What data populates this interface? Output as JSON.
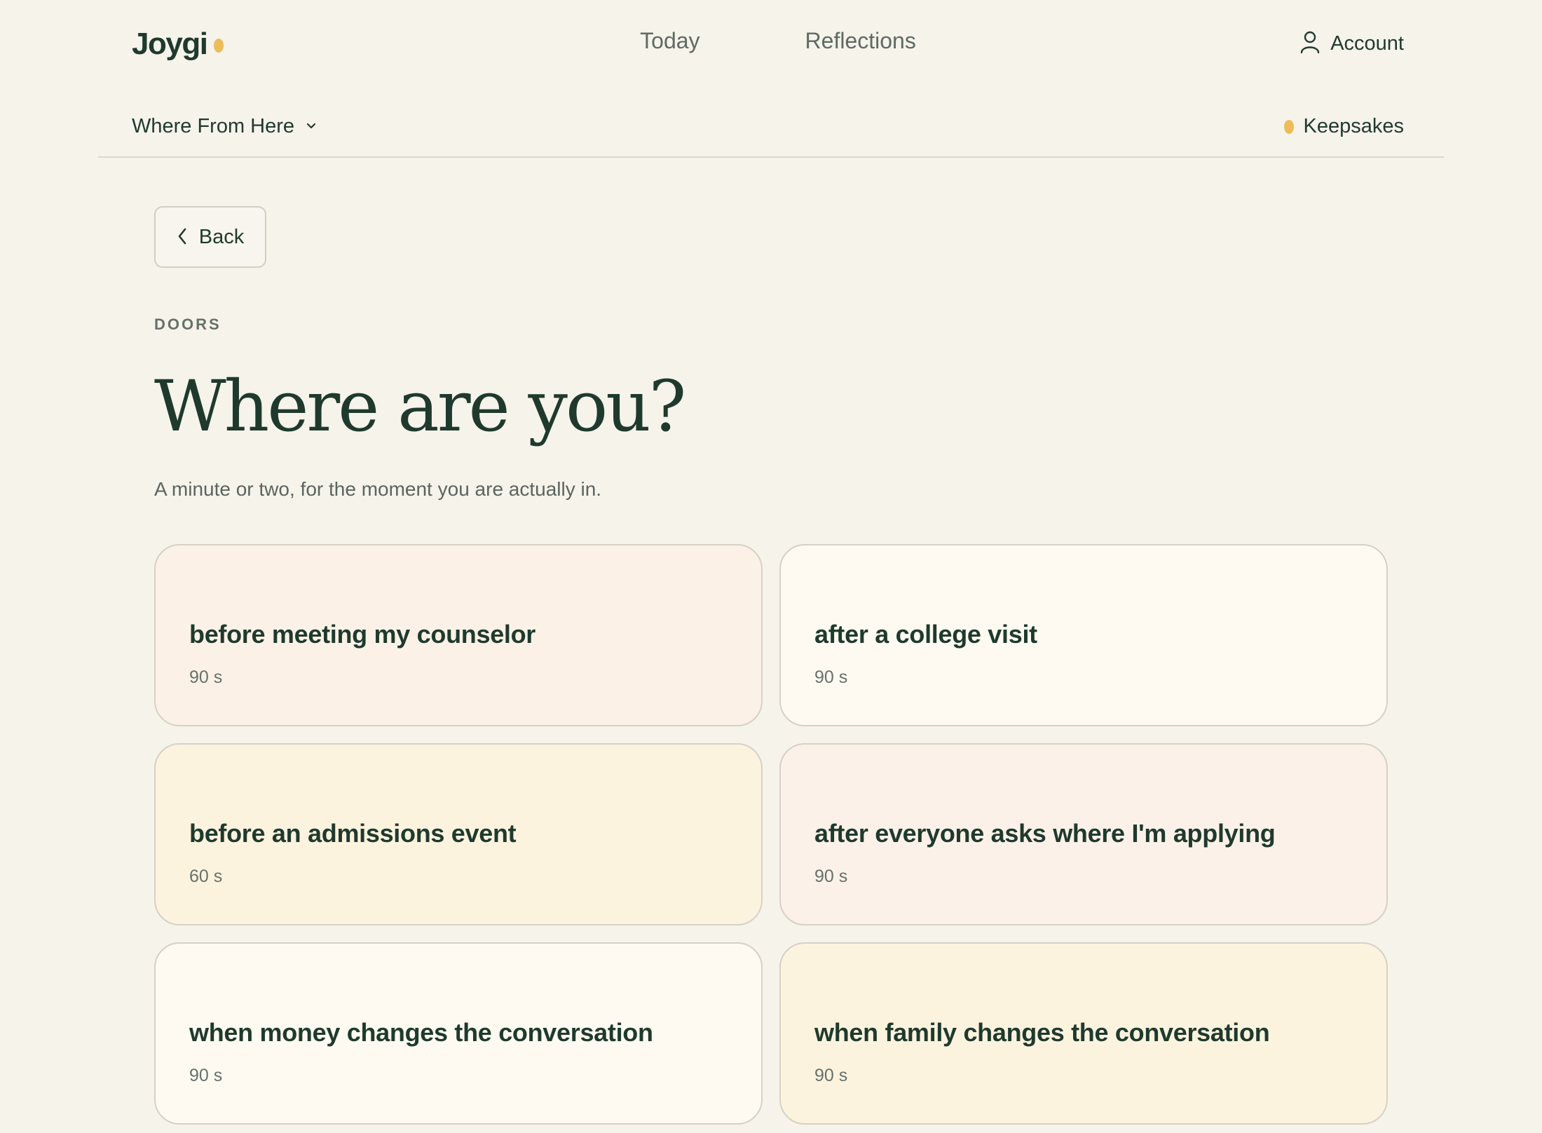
{
  "brand": {
    "name": "Joygi",
    "accent": "#ecbd58",
    "ink": "#1f3a2d",
    "background": "#f6f3eb"
  },
  "nav": {
    "tabs": [
      {
        "label": "Today"
      },
      {
        "label": "Reflections"
      }
    ],
    "account_label": "Account",
    "account_icon": "user-icon"
  },
  "subnav": {
    "section_label": "Where From Here",
    "section_icon": "chevron-down-icon",
    "keepsakes_label": "Keepsakes"
  },
  "main": {
    "back_label": "Back",
    "eyebrow": "DOORS",
    "title": "Where are you?",
    "subtitle": "A minute or two, for the moment you are actually in."
  },
  "cards": [
    {
      "title": "before meeting my counselor",
      "duration": "90 s",
      "color": "#fcf1e7"
    },
    {
      "title": "after a college visit",
      "duration": "90 s",
      "color": "#fefaf2"
    },
    {
      "title": "before an admissions event",
      "duration": "60 s",
      "color": "#fcf3df"
    },
    {
      "title": "after everyone asks where I'm applying",
      "duration": "90 s",
      "color": "#fcf1e9"
    },
    {
      "title": "when money changes the conversation",
      "duration": "90 s",
      "color": "#fefaf2"
    },
    {
      "title": "when family changes the conversation",
      "duration": "90 s",
      "color": "#fcf3df"
    }
  ]
}
